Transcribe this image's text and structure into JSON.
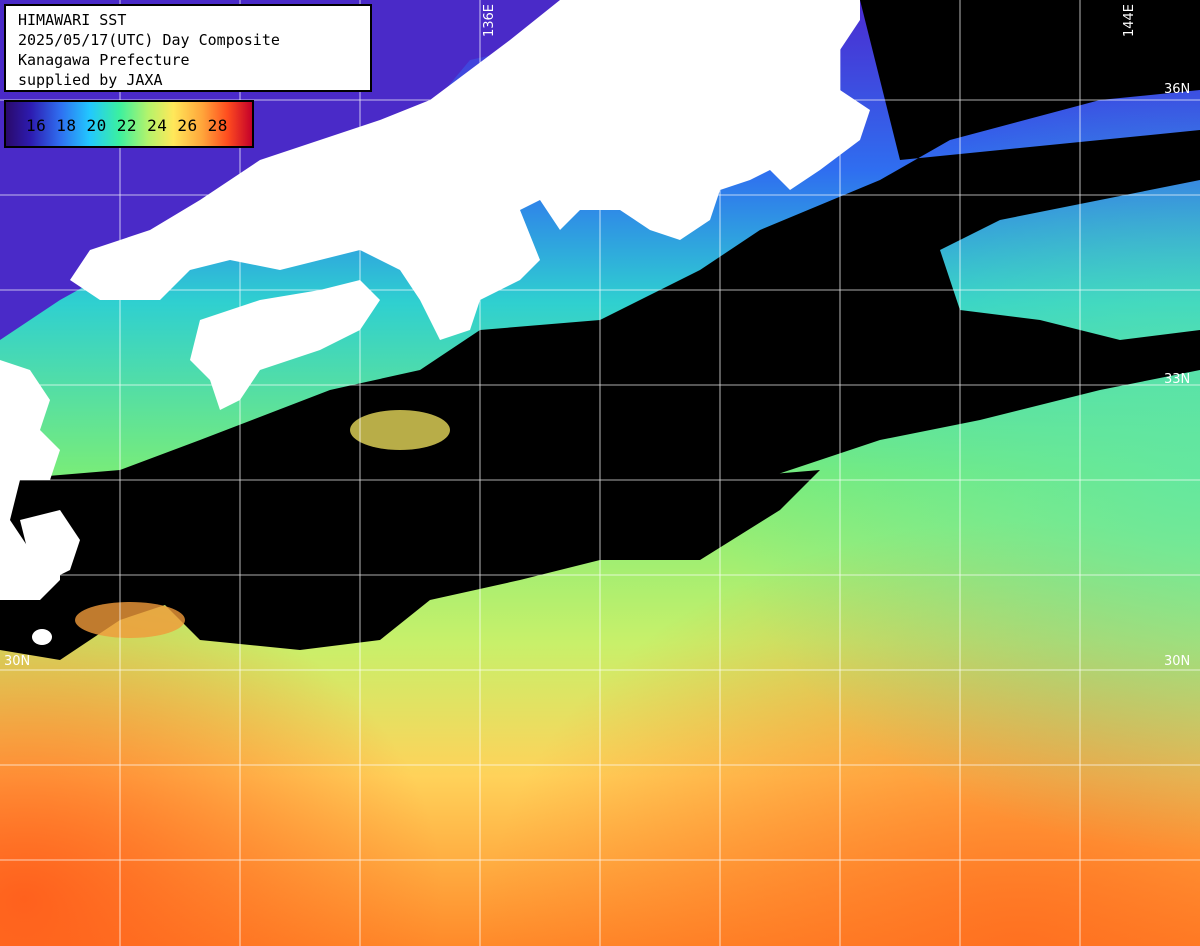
{
  "title_box": {
    "line1": "HIMAWARI SST",
    "line2": "2025/05/17(UTC) Day Composite",
    "line3": "Kanagawa Prefecture",
    "line4": "supplied by JAXA"
  },
  "legend": {
    "ticks": [
      "16",
      "18",
      "20",
      "22",
      "24",
      "26",
      "28"
    ],
    "colors": [
      "#2a0a6b",
      "#2f6ef0",
      "#22c8ff",
      "#3bf0a0",
      "#ffe85a",
      "#ffa43a",
      "#c4002a"
    ]
  },
  "grid_labels": {
    "lon_136": "136E",
    "lon_144": "144E",
    "lat_36": "36N",
    "lat_33": "33N",
    "lat_30": "30N",
    "lat_30_left": "30N"
  },
  "colors": {
    "land": "#ffffff",
    "cloud_mask": "#000000",
    "grid": "#ffffff"
  }
}
